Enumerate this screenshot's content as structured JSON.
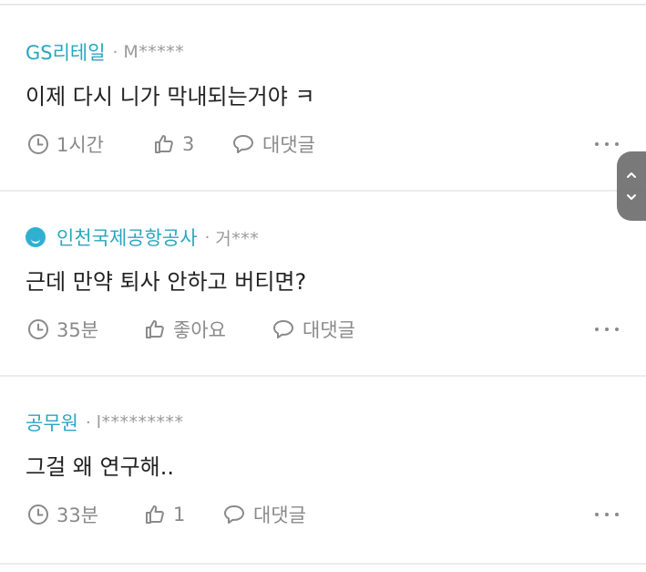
{
  "comments": [
    {
      "company": "GS리테일",
      "separator": "·",
      "user": "M*****",
      "text": "이제 다시 니가 막내되는거야 ㅋ",
      "time": "1시간",
      "likes": "3",
      "reply_label": "대댓글",
      "has_badge": false
    },
    {
      "company": "인천국제공항공사",
      "separator": "·",
      "user": "거***",
      "text": "근데 만약 퇴사 안하고 버티면?",
      "time": "35분",
      "likes": "좋아요",
      "reply_label": "대댓글",
      "has_badge": true
    },
    {
      "company": "공무원",
      "separator": "·",
      "user": "l*********",
      "text": "그걸 왜 연구해..",
      "time": "33분",
      "likes": "1",
      "reply_label": "대댓글",
      "has_badge": false
    }
  ],
  "icons": {
    "time": "clock-icon",
    "like": "thumbs-up-icon",
    "reply": "speech-bubble-icon",
    "more": "more-dots-icon",
    "scroll_up": "chevron-up-icon",
    "scroll_down": "chevron-down-icon"
  },
  "colors": {
    "company": "#2aa6c0",
    "meta": "#8a8a8a",
    "text": "#222222",
    "badge": "#2fb0d1"
  }
}
